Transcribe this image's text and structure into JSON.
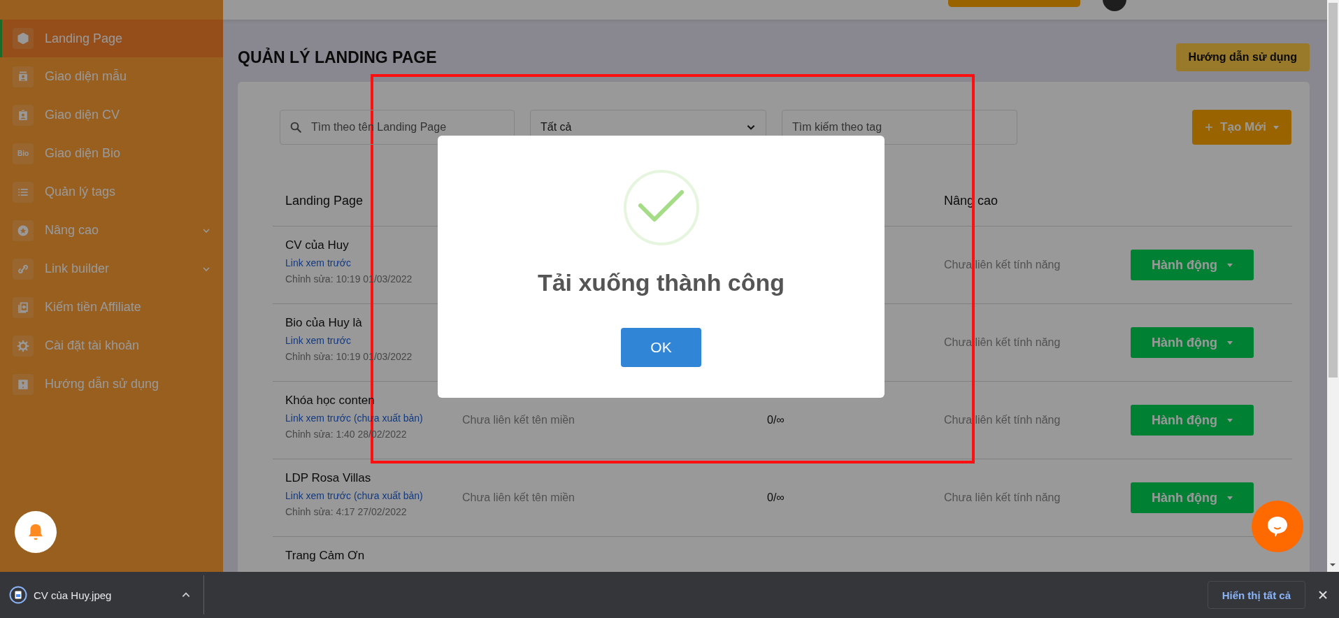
{
  "sidebar": {
    "items": [
      {
        "label": "Landing Page",
        "selected": true,
        "kind": "link"
      },
      {
        "label": "Giao diện mẫu",
        "selected": false,
        "kind": "link"
      },
      {
        "label": "Giao diện CV",
        "selected": false,
        "kind": "link"
      },
      {
        "label": "Giao diện Bio",
        "selected": false,
        "kind": "link",
        "icon_text": "Bio"
      },
      {
        "label": "Quản lý tags",
        "selected": false,
        "kind": "link"
      },
      {
        "label": "Nâng cao",
        "selected": false,
        "kind": "submenu"
      },
      {
        "label": "Link builder",
        "selected": false,
        "kind": "submenu"
      },
      {
        "label": "Kiếm tiền Affiliate",
        "selected": false,
        "kind": "link"
      },
      {
        "label": "Cài đặt tài khoản",
        "selected": false,
        "kind": "link"
      },
      {
        "label": "Hướng dẫn sử dụng",
        "selected": false,
        "kind": "link"
      }
    ]
  },
  "page": {
    "title": "QUẢN LÝ LANDING PAGE",
    "help_button": "Hướng dẫn sử dụng"
  },
  "filters": {
    "search": {
      "placeholder": "Tìm theo tên Landing Page"
    },
    "status_select": {
      "value": "Tất cả"
    },
    "tag_search": {
      "placeholder": "Tìm kiếm theo tag"
    },
    "create_button": "Tạo Mới"
  },
  "table": {
    "columns": [
      "Landing Page",
      "Nâng cao"
    ],
    "rows": [
      {
        "name": "CV của Huy",
        "preview_link": "Link xem trước",
        "edited": "Chỉnh sửa: 10:19 01/03/2022",
        "feature": "Chưa liên kết tính năng",
        "action": "Hành động"
      },
      {
        "name": "Bio của Huy là",
        "preview_link": "Link xem trước",
        "edited": "Chỉnh sửa: 10:19 01/03/2022",
        "feature": "Chưa liên kết tính năng",
        "action": "Hành động"
      },
      {
        "name": "Khóa học conten",
        "preview_link": "Link xem trước (chưa xuất bản)",
        "edited": "Chỉnh sửa: 1:40 28/02/2022",
        "domain": "Chưa liên kết tên miền",
        "quota": "0/∞",
        "feature": "Chưa liên kết tính năng",
        "action": "Hành động"
      },
      {
        "name": "LDP Rosa Villas",
        "preview_link": "Link xem trước (chưa xuất bản)",
        "edited": "Chỉnh sửa: 4:17 27/02/2022",
        "domain": "Chưa liên kết tên miền",
        "quota": "0/∞",
        "feature": "Chưa liên kết tính năng",
        "action": "Hành động"
      },
      {
        "name": "Trang Cảm Ơn"
      }
    ]
  },
  "modal": {
    "title": "Tải xuống thành công",
    "ok_button": "OK"
  },
  "download_bar": {
    "file_name": "CV của Huy.jpeg",
    "show_all_button": "Hiển thị tất cả"
  }
}
